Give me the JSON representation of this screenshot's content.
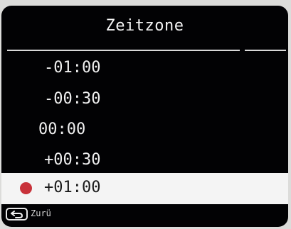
{
  "header": {
    "title": "Zeitzone"
  },
  "timezone_list": {
    "options": [
      {
        "label": "-01:00",
        "selected": false
      },
      {
        "label": "-00:30",
        "selected": false
      },
      {
        "label": "00:00",
        "selected": false
      },
      {
        "label": "+00:30",
        "selected": false
      },
      {
        "label": "+01:00",
        "selected": true
      }
    ]
  },
  "footer": {
    "back_icon": "back-arrow-icon",
    "back_label": "Zurü"
  },
  "colors": {
    "background": "#020204",
    "text": "#f0f0f0",
    "selected_row": "#f4f4f4",
    "selected_marker": "#c8323a"
  }
}
